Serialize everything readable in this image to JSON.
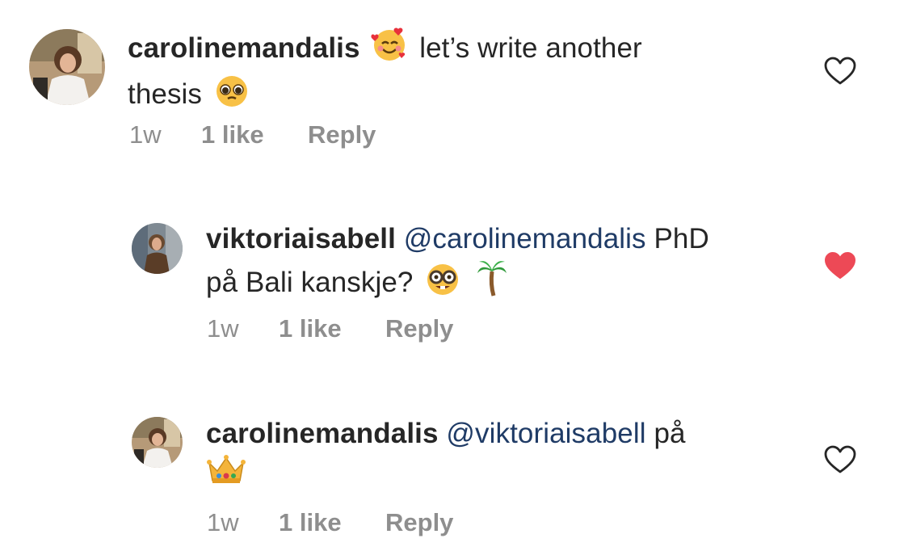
{
  "comments": [
    {
      "username": "carolinemandalis",
      "text_before": "",
      "text_after": "let’s write another",
      "line2": "thesis",
      "time": "1w",
      "likes": "1 like",
      "reply": "Reply",
      "liked": false,
      "emojis": [
        "smiling-face-with-hearts",
        "pleading-face"
      ]
    },
    {
      "username": "viktoriaisabell",
      "mention": "@carolinemandalis",
      "text_after": "PhD",
      "line2": "på Bali kanskje?",
      "time": "1w",
      "likes": "1 like",
      "reply": "Reply",
      "liked": true,
      "emojis": [
        "nerd-face",
        "palm-tree"
      ]
    },
    {
      "username": "carolinemandalis",
      "mention": "@viktoriaisabell",
      "text_after": "på",
      "time": "1w",
      "likes": "1 like",
      "reply": "Reply",
      "liked": false,
      "emojis": [
        "crown"
      ]
    }
  ],
  "colors": {
    "liked": "#ed4956",
    "mention": "#1f3b66",
    "meta": "#8e8e8e",
    "text": "#262626"
  }
}
